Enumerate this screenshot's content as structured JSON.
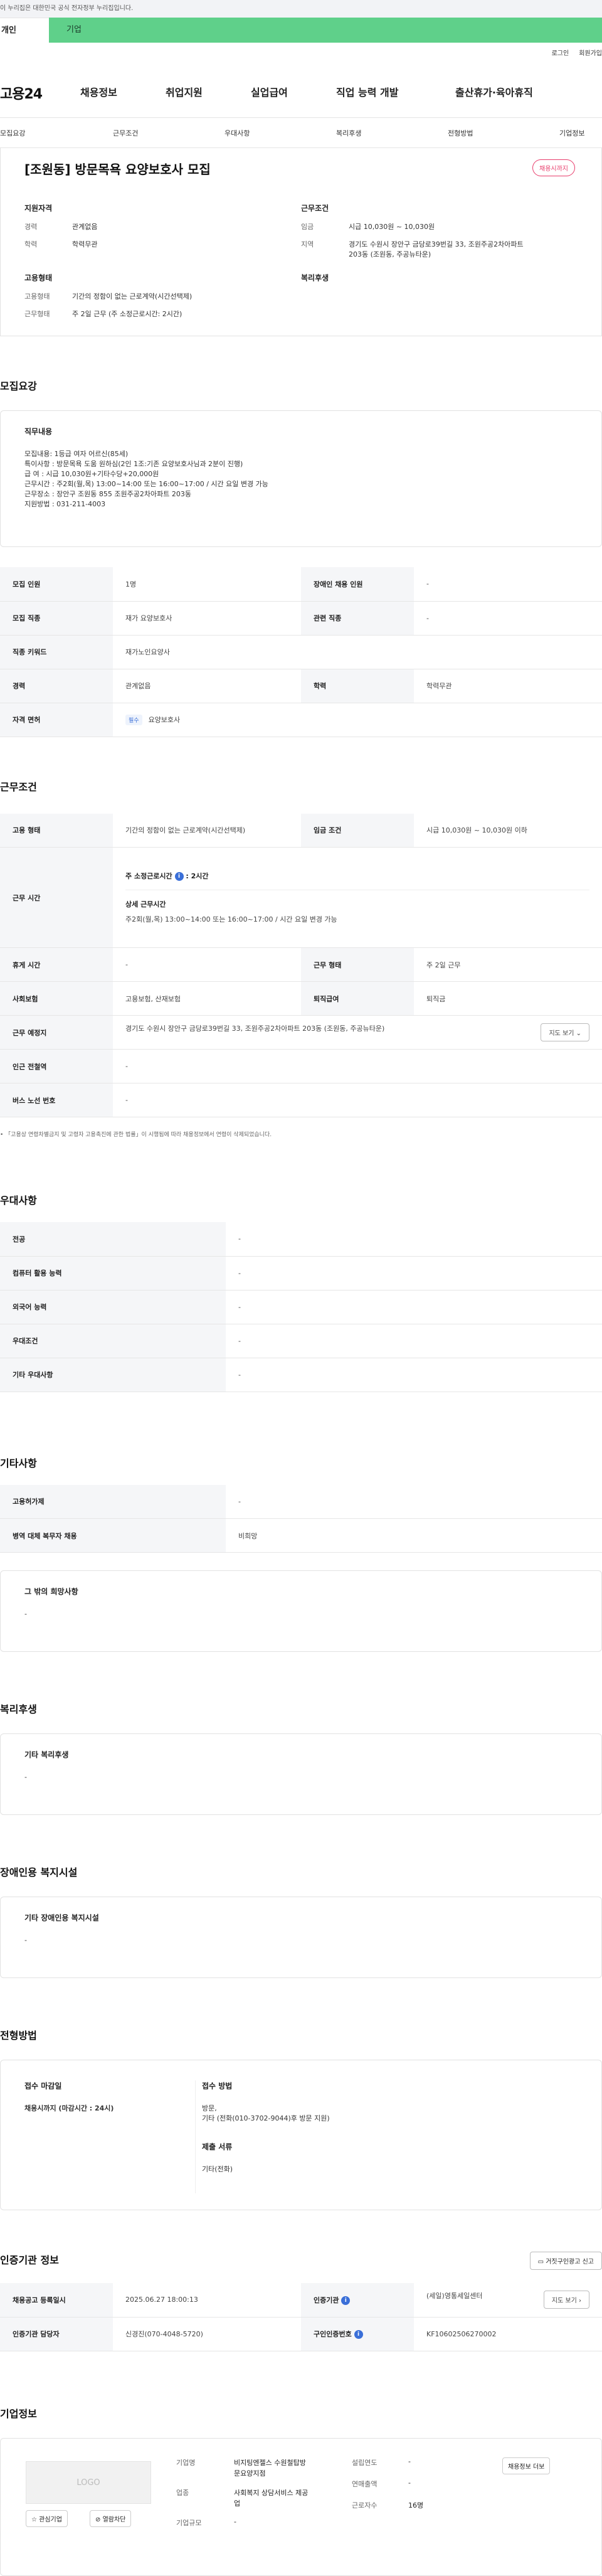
{
  "gov_banner": "이 누리집은 대한민국 공식 전자정부 누리집입니다.",
  "tabs": {
    "individual": "개인",
    "corporate": "기업"
  },
  "util": {
    "login": "로그인",
    "signup": "회원가입"
  },
  "logo": "고용24",
  "gnb": [
    "채용정보",
    "취업지원",
    "실업급여",
    "직업 능력 개발",
    "출산휴가·육아휴직"
  ],
  "anchors": [
    "모집요강",
    "근무조건",
    "우대사항",
    "복리후생",
    "전형방법",
    "기업정보"
  ],
  "summary": {
    "title": "[조원동] 방문목욕 요양보호사 모집",
    "badge": "채용시까지",
    "qual_h": "지원자격",
    "career_k": "경력",
    "career_v": "관계없음",
    "edu_k": "학력",
    "edu_v": "학력무관",
    "cond_h": "근무조건",
    "wage_k": "임금",
    "wage_v": "시급 10,030원 ~ 10,030원",
    "region_k": "지역",
    "region_v": "경기도 수원시 장안구 금당로39번길 33, 조원주공2차아파트 203동 (조원동, 주공뉴타운)",
    "emp_h": "고용형태",
    "emptype_k": "고용형태",
    "emptype_v": "기간의 정함이 없는 근로계약(시간선택제)",
    "worktype_k": "근무형태",
    "worktype_v": "주 2일 근무 (주 소정근로시간: 2시간)",
    "welfare_h": "복리후생"
  },
  "recruit": {
    "title": "모집요강",
    "box_h": "직무내용",
    "box_t": "모집내용: 1등급 여자 어르신(85세)\n특이사항 : 방문목욕 도움 원하심(2인 1조:기존 요양보호사님과 2분이 진행)\n급     여 : 시급 10,030원+기타수당+20,000원\n근무시간 : 주2회(월,목) 13:00~14:00 또는 16:00~17:00 / 시간 요일 변경 가능\n근무장소 : 장안구 조원동 855 조원주공2차아파트 203동\n지원방법 : 031-211-4003",
    "rows": [
      [
        "모집 인원",
        "1명",
        "장애인 채용 인원",
        "-"
      ],
      [
        "모집 직종",
        "재가 요양보호사",
        "관련 직종",
        "-"
      ],
      [
        "직종 키워드",
        "재가노인요양사",
        "",
        ""
      ],
      [
        "경력",
        "관계없음",
        "학력",
        "학력무관"
      ],
      [
        "자격 면허",
        "요양보호사",
        "",
        ""
      ]
    ],
    "req_tag": "필수"
  },
  "conditions": {
    "title": "근무조건",
    "emp_k": "고용 형태",
    "emp_v": "기간의 정함이 없는 근로계약(시간선택제)",
    "wage_k": "임금 조건",
    "wage_v": "시급 10,030원 ~ 10,030원 이하",
    "time_k": "근무 시간",
    "time_h1": "주 소정근로시간",
    "time_h1v": ": 2시간",
    "time_h2": "상세 근무시간",
    "time_v2": "주2회(월,목) 13:00~14:00 또는 16:00~17:00 / 시간 요일 변경 가능",
    "rest_k": "휴게 시간",
    "rest_v": "-",
    "wtype_k": "근무 형태",
    "wtype_v": "주 2일 근무",
    "ins_k": "사회보험",
    "ins_v": "고용보험, 산재보험",
    "sev_k": "퇴직급여",
    "sev_v": "퇴직금",
    "place_k": "근무 예정지",
    "place_v": "경기도 수원시 장안구 금당로39번길 33, 조원주공2차아파트 203동 (조원동, 주공뉴타운)",
    "map_btn": "지도 보기",
    "subway_k": "인근 전철역",
    "subway_v": "-",
    "bus_k": "버스 노선 번호",
    "bus_v": "-",
    "note": "「고용상 연령차별금지 및 고령자 고용촉진에 관한 법률」이 시행됨에 따라 채용정보에서 연령이 삭제되었습니다."
  },
  "preferred": {
    "title": "우대사항",
    "rows": [
      [
        "전공",
        "-"
      ],
      [
        "컴퓨터 활용 능력",
        "-"
      ],
      [
        "외국어 능력",
        "-"
      ],
      [
        "우대조건",
        "-"
      ],
      [
        "기타 우대사항",
        "-"
      ]
    ]
  },
  "other": {
    "title": "기타사항",
    "rows": [
      [
        "고용허가제",
        "-"
      ],
      [
        "병역 대체 복무자 채용",
        "비희망"
      ]
    ],
    "box_h": "그 밖의 희망사항",
    "box_t": "-"
  },
  "welfare": {
    "title": "복리후생",
    "box_h": "기타 복리후생",
    "box_t": "-"
  },
  "disability": {
    "title": "장애인용 복지시설",
    "box_h": "기타 장애인용 복지시설",
    "box_t": "-"
  },
  "selection": {
    "title": "전형방법",
    "deadline_h": "접수 마감일",
    "deadline_v": "채용시까지 (마감시간 : 24시)",
    "method_h": "접수 방법",
    "method_v": "방문,\n기타 (전화(010-3702-9044)후 방문 지원)",
    "docs_h": "제출 서류",
    "docs_v": "기타(전화)"
  },
  "agency": {
    "title": "인증기관 정보",
    "report_btn": "거짓구인광고 신고",
    "reg_k": "채용공고 등록일시",
    "reg_v": "2025.06.27 18:00:13",
    "org_k": "인증기관",
    "org_v": "(세일)영통세일센터",
    "map_btn": "지도 보기",
    "mgr_k": "인증기관 담당자",
    "mgr_v": "신경진(070-4048-5720)",
    "id_k": "구인인증번호",
    "id_v": "KF10602506270002"
  },
  "company": {
    "title": "기업정보",
    "logo_ph": "LOGO",
    "fav_btn": "관심기업",
    "block_btn": "열람차단",
    "name_k": "기업명",
    "name_v": "비지팅엔젤스 수원철탑방문요양지점",
    "ind_k": "업종",
    "ind_v": "사회복지 상담서비스 제공업",
    "size_k": "기업규모",
    "size_v": "-",
    "year_k": "설립연도",
    "year_v": "-",
    "sales_k": "연매출액",
    "sales_v": "-",
    "emp_k": "근로자수",
    "emp_v": "16명",
    "more_btn": "채용정보 더보"
  },
  "colors": {
    "tab_green": "#5fd08a",
    "badge_red": "#e83c6b",
    "info_blue": "#3a6fd8"
  }
}
